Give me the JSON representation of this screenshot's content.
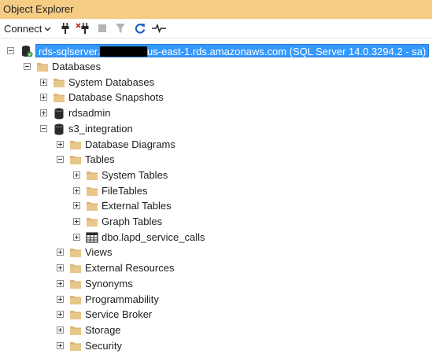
{
  "panel": {
    "title": "Object Explorer"
  },
  "toolbar": {
    "connect_label": "Connect",
    "connect_dropdown_icon": "chevron-down-icon",
    "connect_icon": "plug-icon",
    "disconnect_icon": "unplug-icon",
    "stop_icon": "stop-icon",
    "filter_icon": "filter-icon",
    "refresh_icon": "refresh-icon",
    "activity_icon": "activity-monitor-icon",
    "colors": {
      "refresh": "#1c64c8",
      "disabled": "#b4b4b4"
    }
  },
  "tree": {
    "server": {
      "label_prefix": "rds-sqlserver.",
      "label_suffix": "us-east-1.rds.amazonaws.com (SQL Server 14.0.3294.2 - sa)",
      "expanded": true,
      "icon": "server-icon"
    },
    "nodes": [
      {
        "label": "Databases",
        "expanded": true,
        "icon": "folder-icon"
      },
      {
        "label": "System Databases",
        "expanded": false,
        "icon": "folder-icon"
      },
      {
        "label": "Database Snapshots",
        "expanded": false,
        "icon": "folder-icon"
      },
      {
        "label": "rdsadmin",
        "expanded": false,
        "icon": "database-icon"
      },
      {
        "label": "s3_integration",
        "expanded": true,
        "icon": "database-icon"
      },
      {
        "label": "Database Diagrams",
        "expanded": false,
        "icon": "folder-icon"
      },
      {
        "label": "Tables",
        "expanded": true,
        "icon": "folder-icon"
      },
      {
        "label": "System Tables",
        "expanded": false,
        "icon": "folder-icon"
      },
      {
        "label": "FileTables",
        "expanded": false,
        "icon": "folder-icon"
      },
      {
        "label": "External Tables",
        "expanded": false,
        "icon": "folder-icon"
      },
      {
        "label": "Graph Tables",
        "expanded": false,
        "icon": "folder-icon"
      },
      {
        "label": "dbo.lapd_service_calls",
        "expanded": false,
        "icon": "table-icon"
      },
      {
        "label": "Views",
        "expanded": false,
        "icon": "folder-icon"
      },
      {
        "label": "External Resources",
        "expanded": false,
        "icon": "folder-icon"
      },
      {
        "label": "Synonyms",
        "expanded": false,
        "icon": "folder-icon"
      },
      {
        "label": "Programmability",
        "expanded": false,
        "icon": "folder-icon"
      },
      {
        "label": "Service Broker",
        "expanded": false,
        "icon": "folder-icon"
      },
      {
        "label": "Storage",
        "expanded": false,
        "icon": "folder-icon"
      },
      {
        "label": "Security",
        "expanded": false,
        "icon": "folder-icon"
      }
    ],
    "colors": {
      "folder": "#dcb67a",
      "selection": "#3399ff"
    }
  }
}
